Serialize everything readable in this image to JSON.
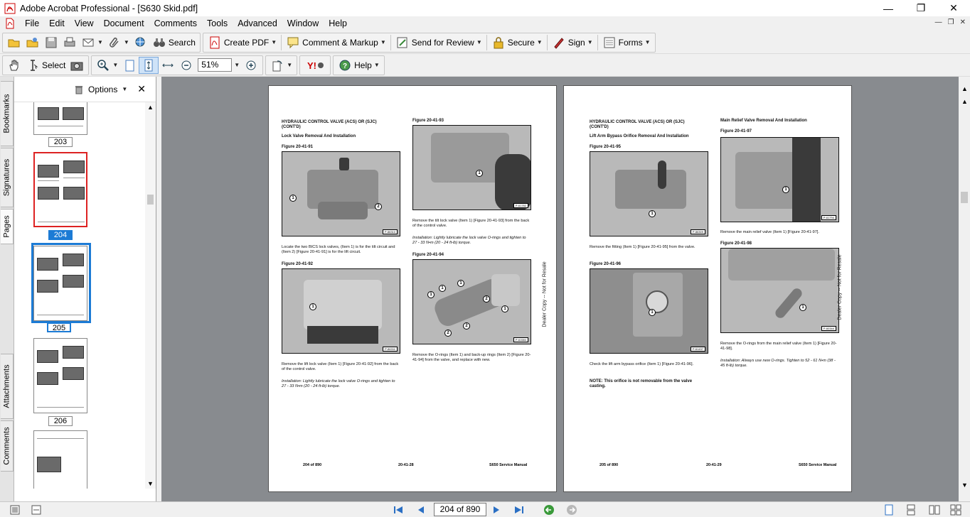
{
  "window": {
    "title": "Adobe Acrobat Professional - [S630 Skid.pdf]"
  },
  "menu": {
    "items": [
      "File",
      "Edit",
      "View",
      "Document",
      "Comments",
      "Tools",
      "Advanced",
      "Window",
      "Help"
    ]
  },
  "toolbar1": {
    "search_label": "Search",
    "create_pdf_label": "Create PDF",
    "comment_markup_label": "Comment & Markup",
    "send_review_label": "Send for Review",
    "secure_label": "Secure",
    "sign_label": "Sign",
    "forms_label": "Forms"
  },
  "toolbar2": {
    "select_label": "Select",
    "zoom_value": "51%",
    "help_label": "Help"
  },
  "left_tabs": [
    "Bookmarks",
    "Signatures",
    "Pages",
    "Attachments",
    "Comments"
  ],
  "pages_panel": {
    "options_label": "Options",
    "thumb_labels": [
      "203",
      "204",
      "205",
      "206"
    ]
  },
  "page_left": {
    "header_left": "HYDRAULIC CONTROL VALVE (ACS) OR (SJC)\n(CONT'D)",
    "subhead_left": "Lock Valve Removal And Installation",
    "fig_91": "Figure 20-41-91",
    "fig_91_code": "P-86310",
    "text_91": "Locate the two BICS lock valves, (Item 1) is for the tilt circuit and (Item 2) [Figure 20-41-91] is for the lift circuit.",
    "fig_92": "Figure 20-41-92",
    "fig_92_code": "P-86311",
    "text_92": "Remove the lift lock valve (Item 1) [Figure 20-41-92] from the back of the control valve.",
    "install_92": "Installation: Lightly lubricate the lock valve O-rings and tighten to 27 - 33 N•m (20 - 24 ft-lb) torque.",
    "fig_93": "Figure 20-41-93",
    "fig_93_code": "P-61782",
    "text_93": "Remove the tilt lock valve (Item 1) [Figure 20-41-93] from the back of the control valve.",
    "install_93": "Installation: Lightly lubricate the lock valve O-rings and tighten to 27 - 33 N•m (20 - 24 ft-lb) torque.",
    "fig_94": "Figure 20-41-94",
    "fig_94_code": "P-61584",
    "text_94": "Remove the O-rings (Item 1) and back-up rings (Item 2) [Figure 20-41-94] from the valve, and replace with new.",
    "footer_left": "204 of 890",
    "footer_mid": "20-41-28",
    "footer_right": "S650 Service Manual",
    "side_text": "Dealer Copy -- Not for Resale"
  },
  "page_right": {
    "header_left": "HYDRAULIC CONTROL VALVE (ACS) OR (SJC)\n(CONT'D)",
    "subhead_left": "Lift Arm Bypass Orifice Removal And Installation",
    "fig_95": "Figure 20-41-95",
    "fig_95_code": "P-86309",
    "text_95": "Remove the fitting (Item 1) [Figure 20-41-95] from the valve.",
    "fig_96": "Figure 20-41-96",
    "fig_96_code": "P-61437",
    "text_96": "Check the lift arm bypass orifice (Item 1) [Figure 20-41-96].",
    "note_96": "NOTE: This orifice is not removable from the valve casting.",
    "subhead_right": "Main Relief Valve Removal And Installation",
    "fig_97": "Figure 20-41-97",
    "fig_97_code": "P-61794",
    "text_97": "Remove the main relief valve (Item 1) [Figure 20-41-97].",
    "fig_98": "Figure 20-41-98",
    "fig_98_code": "P-60344",
    "text_98": "Remove the O-rings from the main relief valve (Item 1) [Figure 20-41-98].",
    "install_98": "Installation: Always use new O-rings. Tighten to 52 - 61 N•m (38 - 45 ft-lb) torque.",
    "footer_left": "205 of 890",
    "footer_mid": "20-41-29",
    "footer_right": "S650 Service Manual",
    "side_text": "Dealer Copy -- Not for Resale"
  },
  "status": {
    "page_indicator": "204 of 890"
  }
}
